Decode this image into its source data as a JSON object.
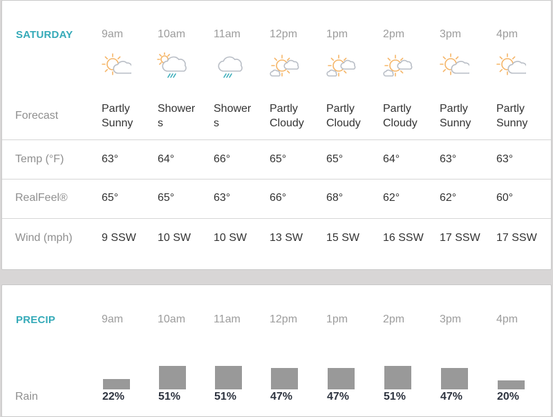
{
  "forecast": {
    "day": "SATURDAY",
    "row_labels": {
      "forecast": "Forecast",
      "temp": "Temp (°F)",
      "realfeel": "RealFeel®",
      "wind": "Wind (mph)"
    },
    "hours": [
      {
        "time": "9am",
        "icon": "partly-sunny-icon",
        "condition": [
          "Partly",
          "Sunny"
        ],
        "temp": "63°",
        "realfeel": "65°",
        "wind": "9 SSW"
      },
      {
        "time": "10am",
        "icon": "showers-sun-icon",
        "condition": [
          "Shower",
          "s"
        ],
        "temp": "64°",
        "realfeel": "65°",
        "wind": "10 SW"
      },
      {
        "time": "11am",
        "icon": "showers-icon",
        "condition": [
          "Shower",
          "s"
        ],
        "temp": "66°",
        "realfeel": "63°",
        "wind": "10 SW"
      },
      {
        "time": "12pm",
        "icon": "partly-cloudy-icon",
        "condition": [
          "Partly",
          "Cloudy"
        ],
        "temp": "65°",
        "realfeel": "66°",
        "wind": "13 SW"
      },
      {
        "time": "1pm",
        "icon": "partly-cloudy-icon",
        "condition": [
          "Partly",
          "Cloudy"
        ],
        "temp": "65°",
        "realfeel": "68°",
        "wind": "15 SW"
      },
      {
        "time": "2pm",
        "icon": "partly-cloudy-icon",
        "condition": [
          "Partly",
          "Cloudy"
        ],
        "temp": "64°",
        "realfeel": "62°",
        "wind": "16 SSW"
      },
      {
        "time": "3pm",
        "icon": "partly-sunny-icon",
        "condition": [
          "Partly",
          "Sunny"
        ],
        "temp": "63°",
        "realfeel": "62°",
        "wind": "17 SSW"
      },
      {
        "time": "4pm",
        "icon": "partly-sunny-icon",
        "condition": [
          "Partly",
          "Sunny"
        ],
        "temp": "63°",
        "realfeel": "60°",
        "wind": "17 SSW"
      }
    ]
  },
  "precip": {
    "title": "PRECIP",
    "row_label": "Rain",
    "hours": [
      "9am",
      "10am",
      "11am",
      "12pm",
      "1pm",
      "2pm",
      "3pm",
      "4pm"
    ],
    "rain_pct": [
      22,
      51,
      51,
      47,
      47,
      51,
      47,
      20
    ],
    "rain_labels": [
      "22%",
      "51%",
      "51%",
      "47%",
      "47%",
      "51%",
      "47%",
      "20%"
    ]
  },
  "colors": {
    "accent": "#35aab8",
    "bar": "#999999",
    "sun": "#f5b567",
    "cloud": "#b9bec6",
    "rain": "#35aab8"
  }
}
